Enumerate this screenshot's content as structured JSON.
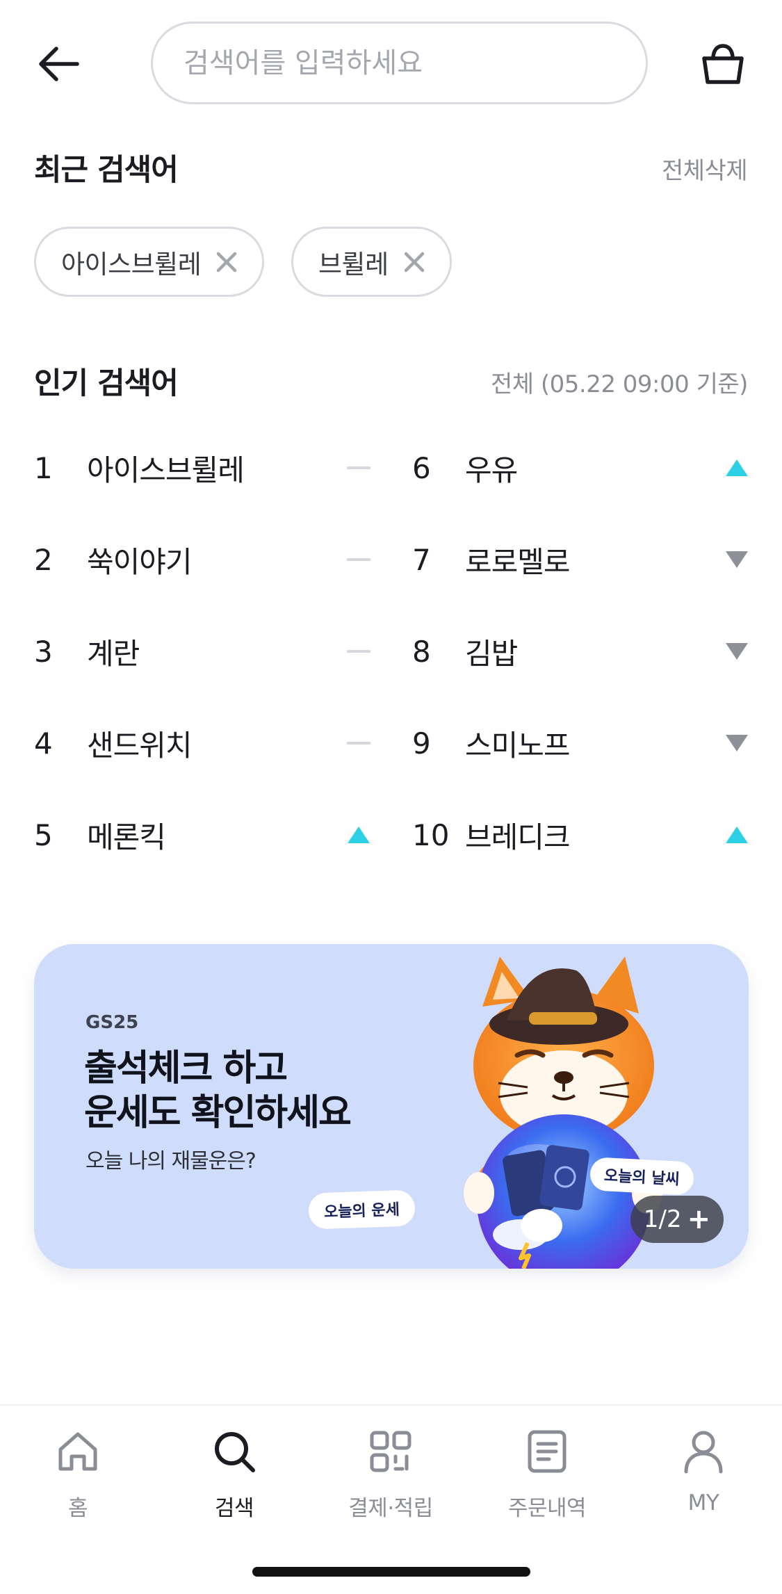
{
  "search": {
    "placeholder": "검색어를 입력하세요"
  },
  "recent": {
    "title": "최근 검색어",
    "clear_all": "전체삭제",
    "chips": [
      "아이스브륄레",
      "브륄레"
    ]
  },
  "popular": {
    "title": "인기 검색어",
    "meta": "전체 (05.22 09:00 기준)",
    "items": [
      {
        "rank": "1",
        "keyword": "아이스브륄레",
        "trend": "same"
      },
      {
        "rank": "2",
        "keyword": "쑥이야기",
        "trend": "same"
      },
      {
        "rank": "3",
        "keyword": "계란",
        "trend": "same"
      },
      {
        "rank": "4",
        "keyword": "샌드위치",
        "trend": "same"
      },
      {
        "rank": "5",
        "keyword": "메론킥",
        "trend": "up"
      },
      {
        "rank": "6",
        "keyword": "우유",
        "trend": "up"
      },
      {
        "rank": "7",
        "keyword": "로로멜로",
        "trend": "down"
      },
      {
        "rank": "8",
        "keyword": "김밥",
        "trend": "down"
      },
      {
        "rank": "9",
        "keyword": "스미노프",
        "trend": "down"
      },
      {
        "rank": "10",
        "keyword": "브레디크",
        "trend": "up"
      }
    ]
  },
  "banner": {
    "brand": "GS25",
    "title_line1": "출석체크 하고",
    "title_line2": "운세도 확인하세요",
    "subtitle": "오늘 나의 재물운은?",
    "tag_fortune": "오늘의 운세",
    "tag_weather": "오늘의 날씨",
    "pager": "1/2",
    "pager_plus": "+"
  },
  "tabs": [
    {
      "label": "홈",
      "icon": "home-icon",
      "active": false
    },
    {
      "label": "검색",
      "icon": "search-icon",
      "active": true
    },
    {
      "label": "결제·적립",
      "icon": "qr-pay-icon",
      "active": false
    },
    {
      "label": "주문내역",
      "icon": "order-list-icon",
      "active": false
    },
    {
      "label": "MY",
      "icon": "profile-icon",
      "active": false
    }
  ],
  "colors": {
    "trend_up": "#2ed0e6",
    "trend_down": "#8e9198",
    "trend_same": "#d5d7dc",
    "banner_bg": "#cfdcfb"
  }
}
